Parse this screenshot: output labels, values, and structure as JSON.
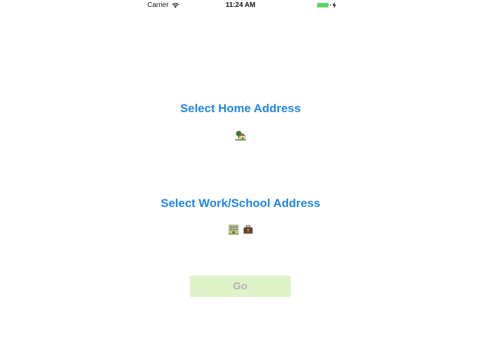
{
  "status_bar": {
    "carrier": "Carrier",
    "time": "11:24 AM",
    "battery_color": "#4cd964"
  },
  "home": {
    "title": "Select Home Address",
    "icons": [
      "house-with-garden-icon"
    ]
  },
  "work": {
    "title": "Select Work/School Address",
    "icons": [
      "office-building-icon",
      "briefcase-icon"
    ]
  },
  "go_button": {
    "label": "Go",
    "background": "#dff3c8",
    "text_color": "#b3b3b3"
  },
  "accent_color": "#1e88e5"
}
